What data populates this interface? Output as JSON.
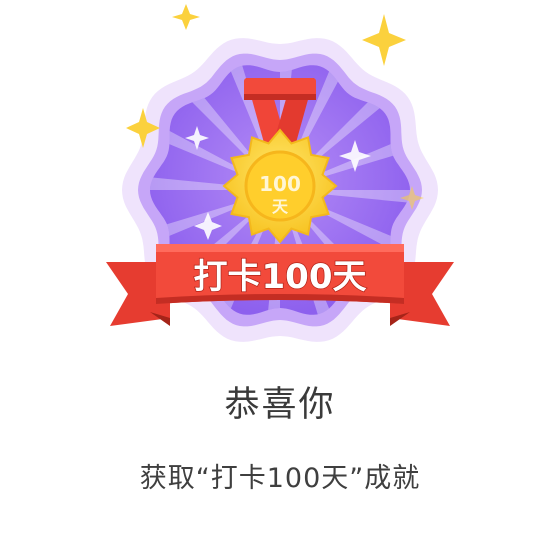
{
  "badge": {
    "ribbon_text": "打卡100天",
    "medal_number": "100",
    "medal_unit": "天",
    "icons": [
      "sparkle-icon",
      "medal-icon",
      "ribbon-banner"
    ],
    "colors": {
      "purple_outer": "#ede0fb",
      "purple_badge": "#a77cf3",
      "purple_inner": "#9266ef",
      "ribbon_red": "#f24a3b",
      "ribbon_dark": "#c42d23",
      "gold": "#ffd63c",
      "star_yellow": "#fbd13d"
    }
  },
  "message": {
    "title": "恭喜你",
    "subtitle": "获取“打卡100天”成就"
  }
}
